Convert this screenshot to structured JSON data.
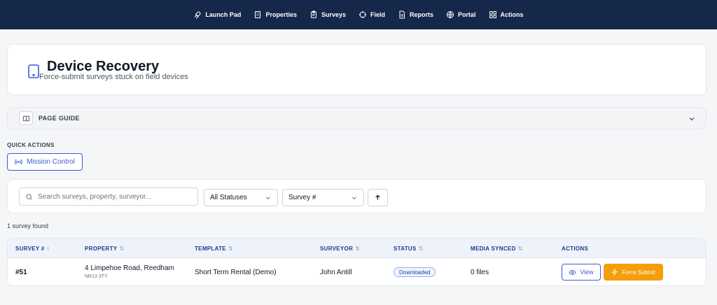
{
  "nav": {
    "items": [
      {
        "label": "Launch Pad",
        "icon": "rocket-icon"
      },
      {
        "label": "Properties",
        "icon": "building-icon"
      },
      {
        "label": "Surveys",
        "icon": "clipboard-icon"
      },
      {
        "label": "Field",
        "icon": "crosshair-icon"
      },
      {
        "label": "Reports",
        "icon": "document-icon"
      },
      {
        "label": "Portal",
        "icon": "globe-icon"
      },
      {
        "label": "Actions",
        "icon": "grid-icon"
      }
    ]
  },
  "header": {
    "title": "Device Recovery",
    "subtitle": "Force-submit surveys stuck on field devices",
    "icon": "tablet-icon"
  },
  "guide": {
    "label": "PAGE GUIDE"
  },
  "quick_actions": {
    "label": "QUICK ACTIONS",
    "mission_control": "Mission Control"
  },
  "filters": {
    "search_placeholder": "Search surveys, property, surveyor...",
    "status_value": "All Statuses",
    "sort_value": "Survey #"
  },
  "results": {
    "count_text": "1 survey found"
  },
  "table": {
    "columns": {
      "survey": "SURVEY #",
      "property": "PROPERTY",
      "template": "TEMPLATE",
      "surveyor": "SURVEYOR",
      "status": "STATUS",
      "media": "MEDIA SYNCED",
      "actions": "ACTIONS"
    },
    "rows": [
      {
        "id": "#51",
        "address": "4 Limpehoe Road, Reedham",
        "postcode": "NR13 3TY",
        "template": "Short Term Rental (Demo)",
        "surveyor": "John Antill",
        "status": "Downloaded",
        "media": "0 files",
        "view_label": "View",
        "force_label": "Force Submit"
      }
    ]
  },
  "colors": {
    "nav_bg": "#16284a",
    "accent": "#3b5bdb",
    "force_button": "#f59e0b",
    "header_row": "#eef3fb"
  }
}
